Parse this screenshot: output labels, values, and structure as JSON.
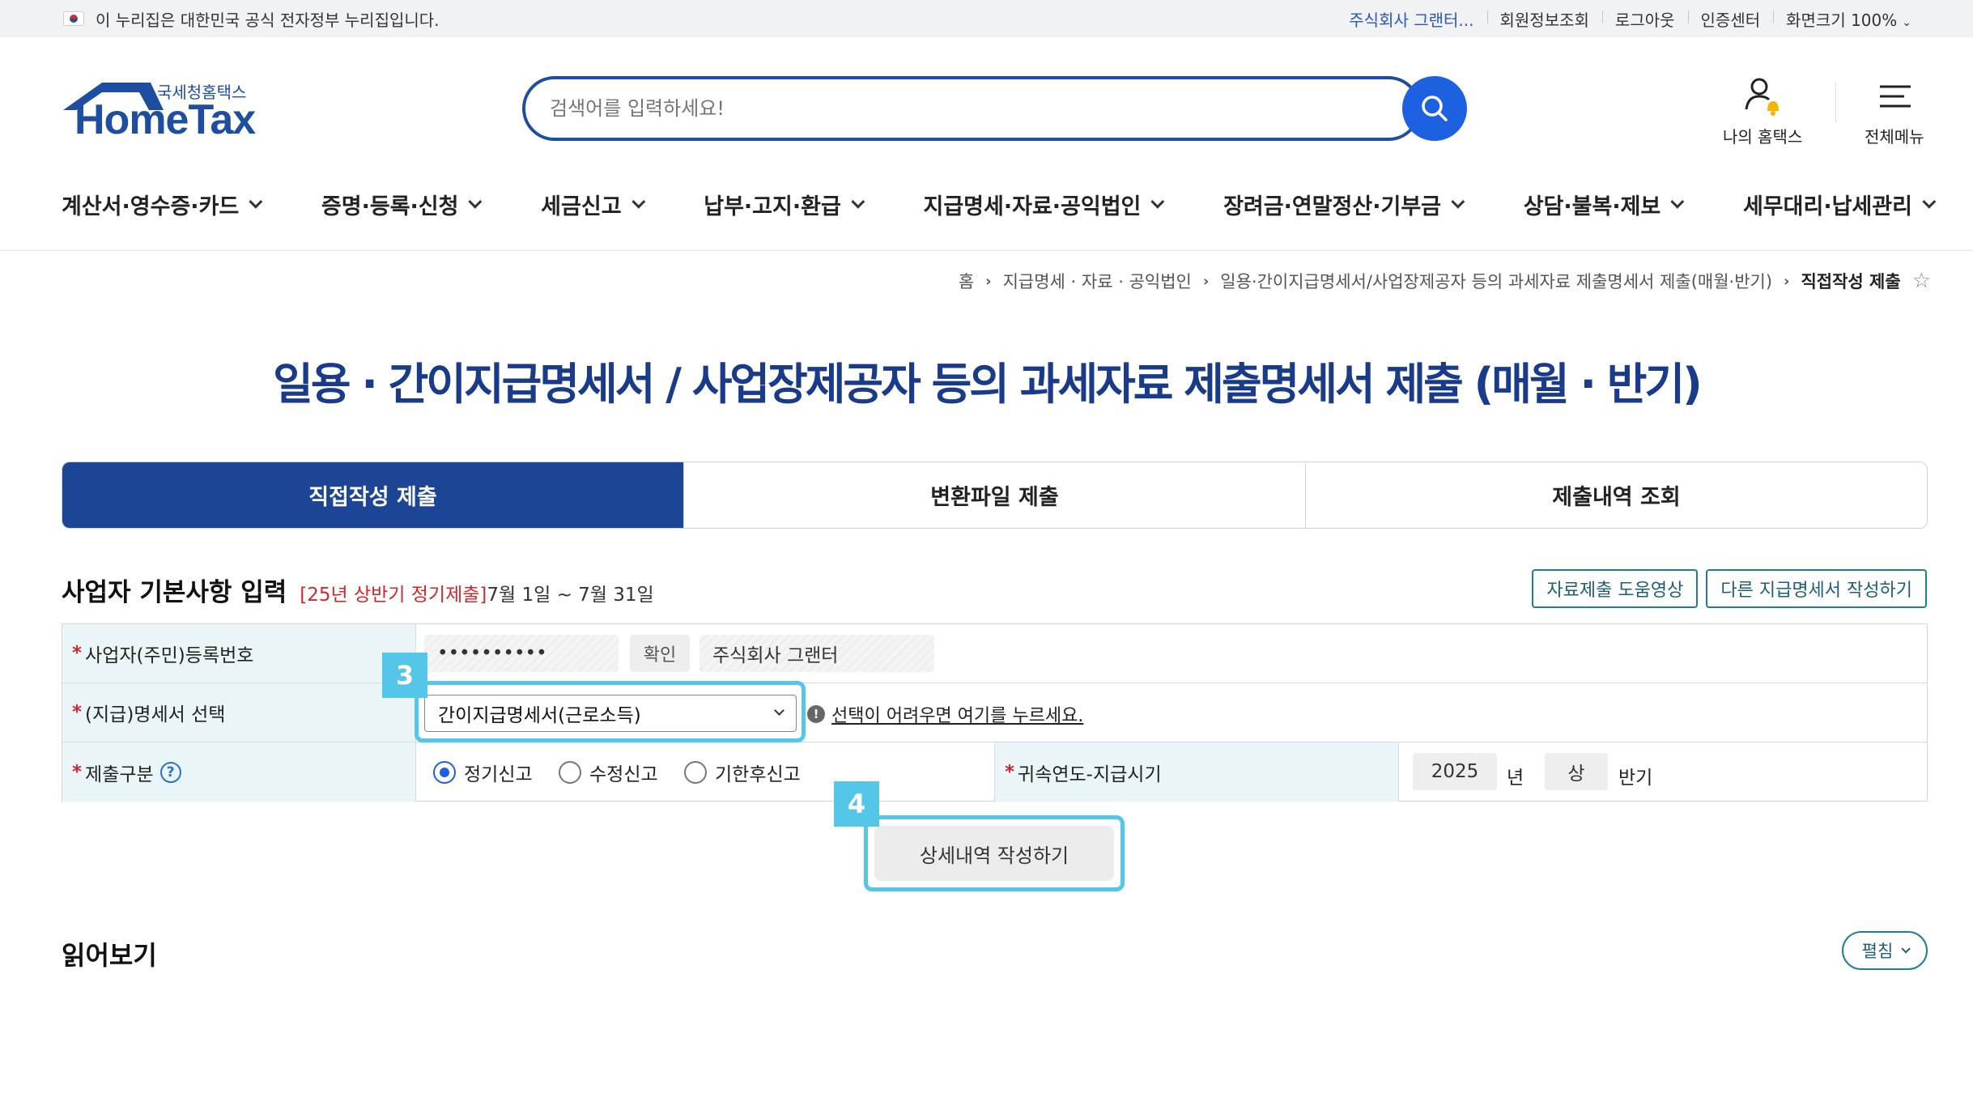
{
  "gov_strip": {
    "notice": "이 누리집은 대한민국 공식 전자정부 누리집입니다.",
    "links": [
      "주식회사 그랜터...",
      "회원정보조회",
      "로그아웃",
      "인증센터"
    ],
    "font_size": "화면크기 100%"
  },
  "header": {
    "logo_small": "국세청홈택스",
    "logo_big": "HomeTax",
    "search_placeholder": "검색어를 입력하세요!",
    "my_hometax": "나의 홈택스",
    "all_menu": "전체메뉴"
  },
  "nav": [
    "계산서·영수증·카드",
    "증명·등록·신청",
    "세금신고",
    "납부·고지·환급",
    "지급명세·자료·공익법인",
    "장려금·연말정산·기부금",
    "상담·불복·제보",
    "세무대리·납세관리"
  ],
  "breadcrumb": {
    "home": "홈",
    "items": [
      "지급명세 · 자료 · 공익법인",
      "일용·간이지급명세서/사업장제공자 등의 과세자료 제출명세서 제출(매월·반기)"
    ],
    "current": "직접작성 제출"
  },
  "page_title": "일용 · 간이지급명세서 / 사업장제공자 등의 과세자료 제출명세서 제출 (매월 · 반기)",
  "tabs": [
    "직접작성 제출",
    "변환파일 제출",
    "제출내역 조회"
  ],
  "section": {
    "title": "사업자 기본사항 입력",
    "period_red": "[25년 상반기 정기제출]",
    "period_date": "7월 1일 ~ 7월 31일",
    "btn_video": "자료제출 도움영상",
    "btn_other": "다른 지급명세서 작성하기"
  },
  "form": {
    "reg_label": "사업자(주민)등록번호",
    "reg_value": "••••••••••",
    "confirm_btn": "확인",
    "company_name": "주식회사 그랜터",
    "statement_label": "(지급)명세서 선택",
    "statement_value": "간이지급명세서(근로소득)",
    "hint_text": "선택이 어려우면 여기를 누르세요.",
    "submit_label": "제출구분",
    "radio_options": [
      "정기신고",
      "수정신고",
      "기한후신고"
    ],
    "period_label": "귀속연도-지급시기",
    "year_value": "2025",
    "year_unit": "년",
    "half_value": "상",
    "half_unit": "반기"
  },
  "callouts": [
    "3",
    "4"
  ],
  "action_btn": "상세내역 작성하기",
  "read_section": {
    "title": "읽어보기",
    "toggle": "펼침"
  },
  "colors": {
    "brand_navy": "#1c4595",
    "search_blue": "#1e61e0",
    "highlight": "#54c7e8",
    "required_red": "#d3262c"
  }
}
